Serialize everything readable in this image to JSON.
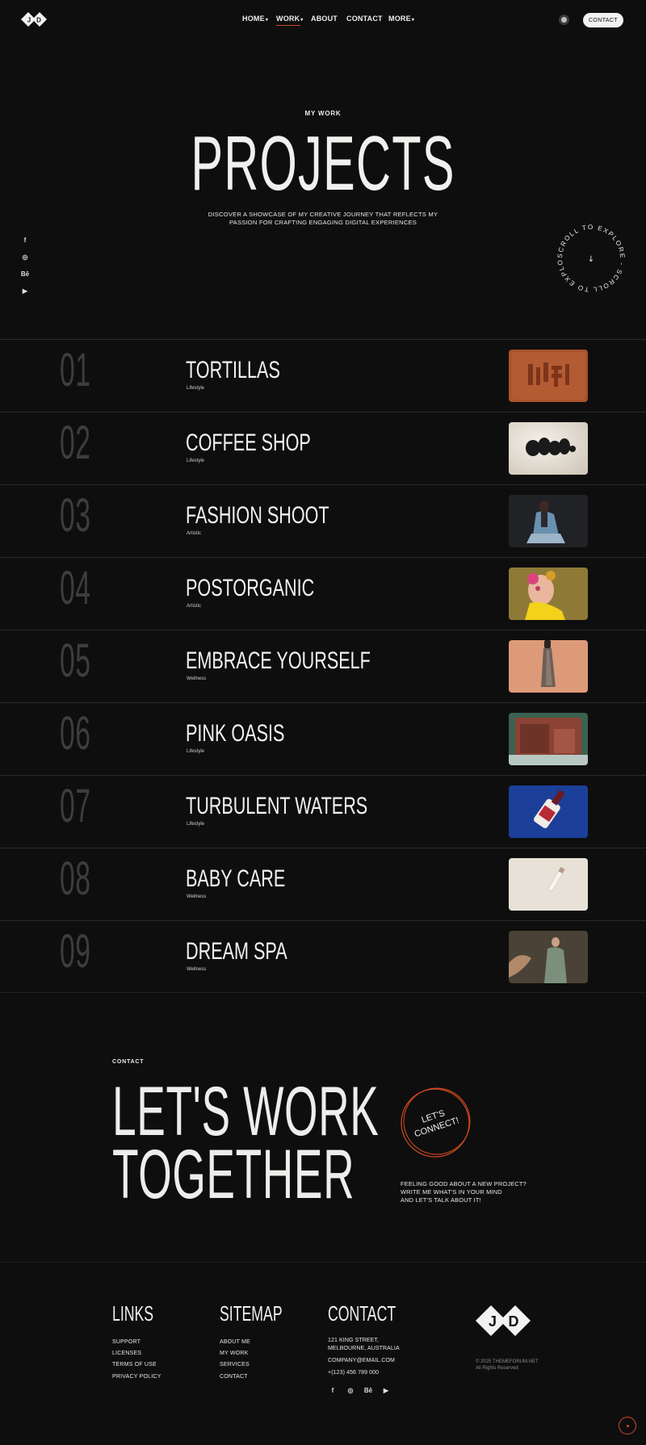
{
  "brand": {
    "initials": [
      "J",
      "D"
    ]
  },
  "nav": {
    "items": [
      {
        "label": "HOME",
        "caret": "▾"
      },
      {
        "label": "WORK",
        "caret": "▾",
        "active": true
      },
      {
        "label": "ABOUT"
      },
      {
        "label": "CONTACT"
      },
      {
        "label": "MORE",
        "caret": "▾"
      }
    ],
    "contact_button": "CONTACT"
  },
  "hero": {
    "eyebrow": "MY WORK",
    "title": "PROJECTS",
    "description": "DISCOVER A SHOWCASE OF MY CREATIVE JOURNEY THAT REFLECTS MY PASSION FOR CRAFTING ENGAGING DIGITAL EXPERIENCES",
    "scroll_text": "SCROLL TO EXPLORE - SCROLL TO EXPLORE - ",
    "scroll_arrow": "↓"
  },
  "socials": [
    "f",
    "◎",
    "Bē",
    "▶"
  ],
  "projects": [
    {
      "num": "01",
      "title": "TORTILLAS",
      "category": "Lifestyle"
    },
    {
      "num": "02",
      "title": "COFFEE SHOP",
      "category": "Lifestyle"
    },
    {
      "num": "03",
      "title": "FASHION SHOOT",
      "category": "Artistic"
    },
    {
      "num": "04",
      "title": "POSTORGANIC",
      "category": "Artistic"
    },
    {
      "num": "05",
      "title": "EMBRACE YOURSELF",
      "category": "Wellness"
    },
    {
      "num": "06",
      "title": "PINK OASIS",
      "category": "Lifestyle"
    },
    {
      "num": "07",
      "title": "TURBULENT WATERS",
      "category": "Lifestyle"
    },
    {
      "num": "08",
      "title": "BABY CARE",
      "category": "Wellness"
    },
    {
      "num": "09",
      "title": "DREAM SPA",
      "category": "Wellness"
    }
  ],
  "contact": {
    "eyebrow": "CONTACT",
    "line1": "LET'S WORK",
    "line2": "TOGETHER",
    "badge_line1": "LET'S",
    "badge_line2": "CONNECT!",
    "copy": [
      "FEELING GOOD ABOUT A NEW PROJECT?",
      "WRITE ME WHAT'S IN YOUR MIND",
      "AND LET'S TALK ABOUT IT!"
    ]
  },
  "footer": {
    "links_heading": "LINKS",
    "links": [
      "SUPPORT",
      "LICENSES",
      "TERMS OF USE",
      "PRIVACY POLICY"
    ],
    "sitemap_heading": "SITEMAP",
    "sitemap": [
      "ABOUT ME",
      "MY WORK",
      "SERVICES",
      "CONTACT"
    ],
    "contact_heading": "CONTACT",
    "address1": "121 KING STREET,",
    "address2": "MELBOURNE, AUSTRALIA",
    "email": "COMPANY@EMAIL.COM",
    "phone": "+(123) 456 789 000",
    "copyright1": "© 2025 THEMEFORUM.NET",
    "copyright2": "All Rights Reserved"
  },
  "colors": {
    "background": "#0e0e0e",
    "accent": "#d24a20",
    "muted_number": "#3d3d3d",
    "text": "#ececec"
  }
}
